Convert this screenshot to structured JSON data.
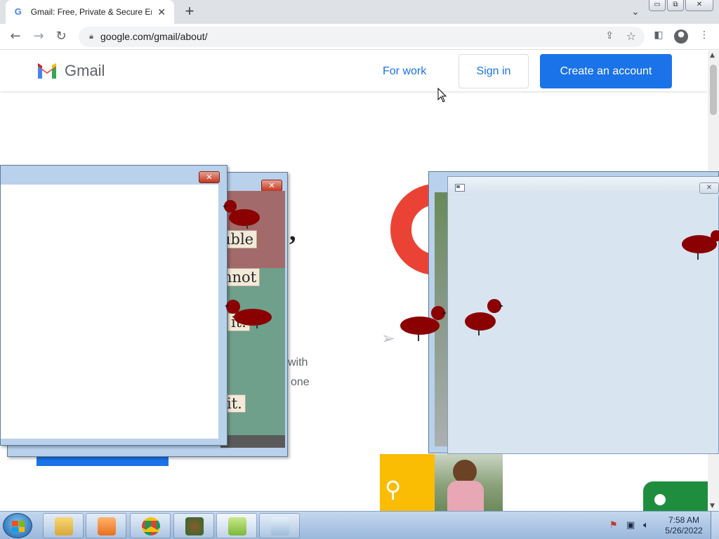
{
  "browser": {
    "tab_title": "Gmail: Free, Private & Secure Em",
    "tab_favicon": "G",
    "tab_close": "✕",
    "new_tab": "+",
    "url": "google.com/gmail/about/",
    "window_buttons": {
      "minimize": "▭",
      "restore": "⧉",
      "close": "✕"
    }
  },
  "page": {
    "brand": "Gmail",
    "nav": {
      "for_work": "For work",
      "sign_in": "Sign in",
      "create_account": "Create an account"
    },
    "hero_fragments": [
      ",",
      "with",
      "one"
    ]
  },
  "overlays": {
    "window_close_glyph": "✕",
    "collage_words": [
      "uble",
      "nnot",
      "it.",
      "it."
    ]
  },
  "taskbar": {
    "time": "7:58 AM",
    "date": "5/26/2022",
    "apps": [
      "file-explorer",
      "media-player",
      "chrome",
      "game-app",
      "notepad-app",
      "writing-app"
    ]
  },
  "colors": {
    "accent": "#1a73e8",
    "gmail_red": "#ea4335",
    "bird": "#8b0000"
  }
}
